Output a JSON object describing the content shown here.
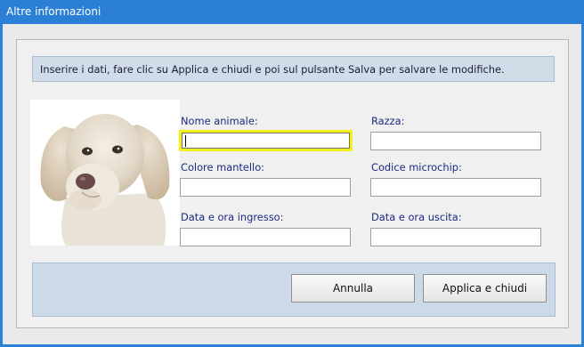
{
  "window": {
    "title": "Altre informazioni"
  },
  "info_text": "Inserire i dati, fare clic su Applica e chiudi e poi sul pulsante Salva per salvare le modifiche.",
  "form": {
    "nome_animale": {
      "label": "Nome animale:",
      "value": ""
    },
    "razza": {
      "label": "Razza:",
      "value": ""
    },
    "colore_mantello": {
      "label": "Colore mantello:",
      "value": ""
    },
    "codice_microchip": {
      "label": "Codice microchip:",
      "value": ""
    },
    "data_ingresso": {
      "label": "Data e ora ingresso:",
      "value": ""
    },
    "data_uscita": {
      "label": "Data e ora uscita:",
      "value": ""
    }
  },
  "buttons": {
    "cancel": "Annulla",
    "apply": "Applica e chiudi"
  },
  "colors": {
    "titlebar": "#2b7fd4",
    "focus_border": "#f2f21a",
    "label_text": "#1c2a80",
    "panel": "#ccd9e6"
  }
}
